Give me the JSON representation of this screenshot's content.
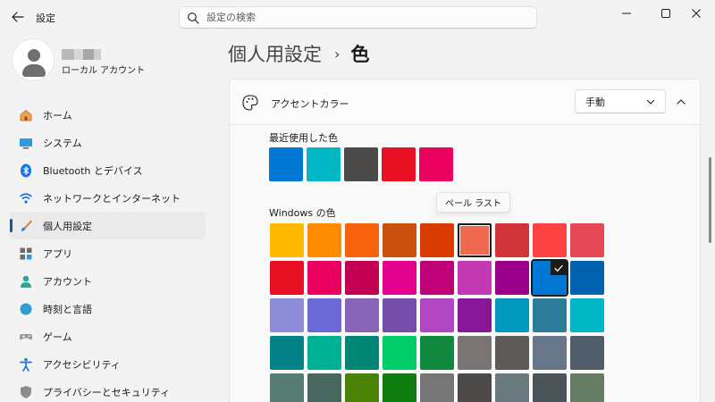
{
  "window": {
    "title": "設定",
    "controls": [
      "minimize-icon",
      "maximize-icon",
      "close-icon"
    ]
  },
  "search": {
    "placeholder": "設定の検索"
  },
  "profile": {
    "account_type": "ローカル アカウント"
  },
  "nav": {
    "items": [
      {
        "label": "ホーム",
        "icon": "home-icon"
      },
      {
        "label": "システム",
        "icon": "system-icon"
      },
      {
        "label": "Bluetooth とデバイス",
        "icon": "bluetooth-icon"
      },
      {
        "label": "ネットワークとインターネット",
        "icon": "wifi-icon"
      },
      {
        "label": "個人用設定",
        "icon": "brush-icon",
        "active": true
      },
      {
        "label": "アプリ",
        "icon": "apps-icon"
      },
      {
        "label": "アカウント",
        "icon": "account-icon"
      },
      {
        "label": "時刻と言語",
        "icon": "globe-icon"
      },
      {
        "label": "ゲーム",
        "icon": "gamepad-icon"
      },
      {
        "label": "アクセシビリティ",
        "icon": "accessibility-icon"
      },
      {
        "label": "プライバシーとセキュリティ",
        "icon": "shield-icon"
      }
    ]
  },
  "breadcrumb": {
    "parent": "個人用設定",
    "separator": "›",
    "current": "色"
  },
  "accent": {
    "title": "アクセントカラー",
    "mode_value": "手動",
    "recent_label": "最近使用した色",
    "recent_colors": [
      "#0078d4",
      "#00b7c3",
      "#4c4a48",
      "#e81123",
      "#ea005e"
    ],
    "windows_label": "Windows の色",
    "tooltip": "ペール ラスト",
    "selected_color": "#0078d4",
    "windows_colors": [
      "#ffb900",
      "#ff8c00",
      "#f7630c",
      "#ca5010",
      "#da3b01",
      "#ef6950",
      "#d13438",
      "#ff4343",
      "#e74856",
      "#e81123",
      "#ea005e",
      "#c30052",
      "#e3008c",
      "#bf0077",
      "#c239b3",
      "#9a0089",
      "#0078d4",
      "#0063b1",
      "#8e8cd8",
      "#6b69d6",
      "#8764b8",
      "#744da9",
      "#b146c2",
      "#881798",
      "#0099bc",
      "#2d7d9a",
      "#00b7c3",
      "#038387",
      "#00b294",
      "#018574",
      "#00cc6a",
      "#10893e",
      "#7a7574",
      "#5d5a58",
      "#68768a",
      "#515c6b",
      "#567c73",
      "#486860",
      "#498205",
      "#107c10",
      "#767676",
      "#4c4a48",
      "#69797e",
      "#4a5459",
      "#647c64"
    ]
  }
}
